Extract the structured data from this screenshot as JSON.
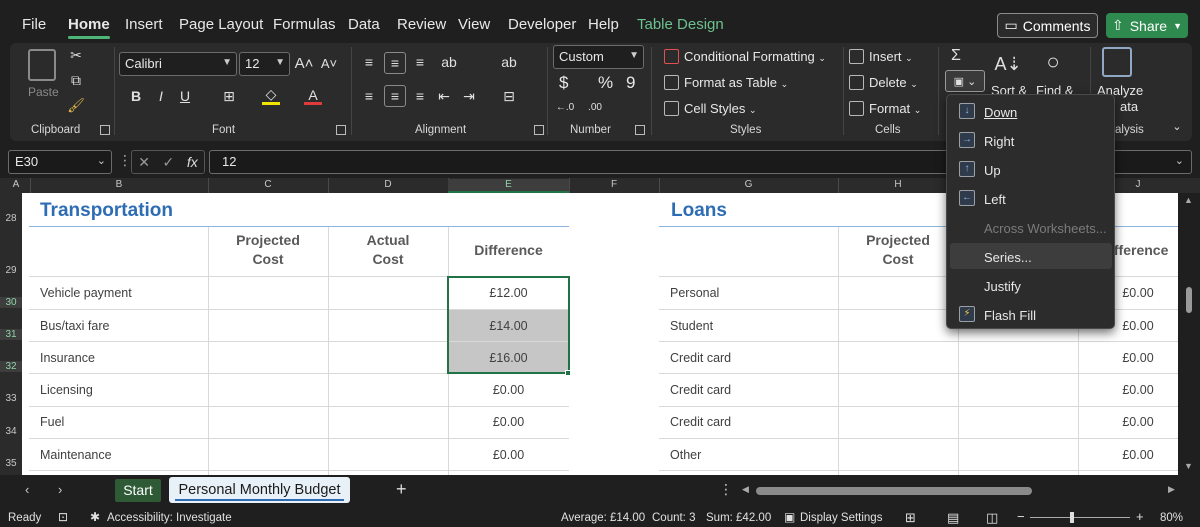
{
  "menu": {
    "tabs": [
      "File",
      "Home",
      "Insert",
      "Page Layout",
      "Formulas",
      "Data",
      "Review",
      "View",
      "Developer",
      "Help",
      "Table Design"
    ],
    "comments_label": "Comments",
    "share_label": "Share"
  },
  "ribbon": {
    "clipboard": {
      "paste": "Paste",
      "label": "Clipboard"
    },
    "font": {
      "name": "Calibri",
      "size": "12",
      "label": "Font"
    },
    "alignment": {
      "label": "Alignment"
    },
    "number": {
      "format": "Custom",
      "currency": "$",
      "percent": "%",
      "comma": "9",
      "label": "Number"
    },
    "styles": {
      "conditional": "Conditional Formatting",
      "format_table": "Format as Table",
      "cell_styles": "Cell Styles",
      "label": "Styles"
    },
    "cells": {
      "insert": "Insert",
      "delete": "Delete",
      "format": "Format",
      "label": "Cells"
    },
    "editing": {
      "sort": "Sort &",
      "find": "Find &"
    },
    "analysis": {
      "line1": "Analyze",
      "line2": "ata",
      "label": "alysis"
    }
  },
  "formula_bar": {
    "name_box": "E30",
    "formula": "12"
  },
  "columns": [
    "A",
    "B",
    "C",
    "D",
    "E",
    "F",
    "G",
    "H",
    "J"
  ],
  "rows": [
    "28",
    "29",
    "30",
    "31",
    "32",
    "33",
    "34",
    "35"
  ],
  "transportation": {
    "title": "Transportation",
    "headers": [
      "Projected\nCost",
      "Actual\nCost",
      "Difference"
    ],
    "items": [
      {
        "label": "Vehicle payment",
        "difference": "£12.00"
      },
      {
        "label": "Bus/taxi fare",
        "difference": "£14.00"
      },
      {
        "label": "Insurance",
        "difference": "£16.00"
      },
      {
        "label": "Licensing",
        "difference": "£0.00"
      },
      {
        "label": "Fuel",
        "difference": "£0.00"
      },
      {
        "label": "Maintenance",
        "difference": "£0.00"
      }
    ]
  },
  "loans": {
    "title": "Loans",
    "headers": [
      "Projected\nCost",
      "ifference"
    ],
    "items": [
      {
        "label": "Personal",
        "difference": "£0.00"
      },
      {
        "label": "Student",
        "difference": "£0.00"
      },
      {
        "label": "Credit card",
        "difference": "£0.00"
      },
      {
        "label": "Credit card",
        "difference": "£0.00"
      },
      {
        "label": "Credit card",
        "difference": "£0.00"
      },
      {
        "label": "Other",
        "difference": "£0.00"
      }
    ]
  },
  "fill_menu": {
    "items": [
      {
        "label": "Down",
        "icon": "fill-down-icon"
      },
      {
        "label": "Right",
        "icon": "fill-right-icon"
      },
      {
        "label": "Up",
        "icon": "fill-up-icon"
      },
      {
        "label": "Left",
        "icon": "fill-left-icon"
      },
      {
        "label": "Across Worksheets...",
        "icon": "",
        "disabled": true
      },
      {
        "label": "Series...",
        "icon": "",
        "hover": true
      },
      {
        "label": "Justify",
        "icon": ""
      },
      {
        "label": "Flash Fill",
        "icon": "flash-fill-icon"
      }
    ]
  },
  "sheets": {
    "start": "Start",
    "active": "Personal Monthly Budget"
  },
  "status": {
    "ready": "Ready",
    "accessibility": "Accessibility: Investigate",
    "average": "Average: £14.00",
    "count": "Count: 3",
    "sum": "Sum: £42.00",
    "display_settings": "Display Settings",
    "zoom": "80%"
  },
  "colors": {
    "accent_green": "#217346",
    "title_blue": "#2e6db4",
    "share_green": "#2f8a4f"
  }
}
